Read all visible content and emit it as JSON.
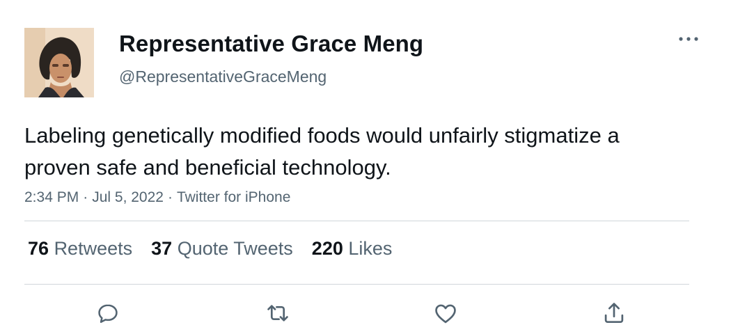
{
  "author": {
    "display_name": "Representative Grace Meng",
    "handle": "@RepresentativeGraceMeng",
    "avatar_icon": "profile-photo"
  },
  "more_icon": "ellipsis-icon",
  "tweet": {
    "text": "Labeling genetically modified foods would unfairly stigmatize a proven safe and beneficial technology.",
    "time": "2:34 PM",
    "date": "Jul 5, 2022",
    "source": "Twitter for iPhone",
    "separator": "·"
  },
  "stats": {
    "retweets_count": "76",
    "retweets_label": "Retweets",
    "quote_tweets_count": "37",
    "quote_tweets_label": "Quote Tweets",
    "likes_count": "220",
    "likes_label": "Likes"
  },
  "actions": [
    "reply-icon",
    "retweet-icon",
    "like-icon",
    "share-icon"
  ],
  "colors": {
    "text_primary": "#0f1419",
    "text_secondary": "#536471",
    "divider": "#d0d6da"
  }
}
